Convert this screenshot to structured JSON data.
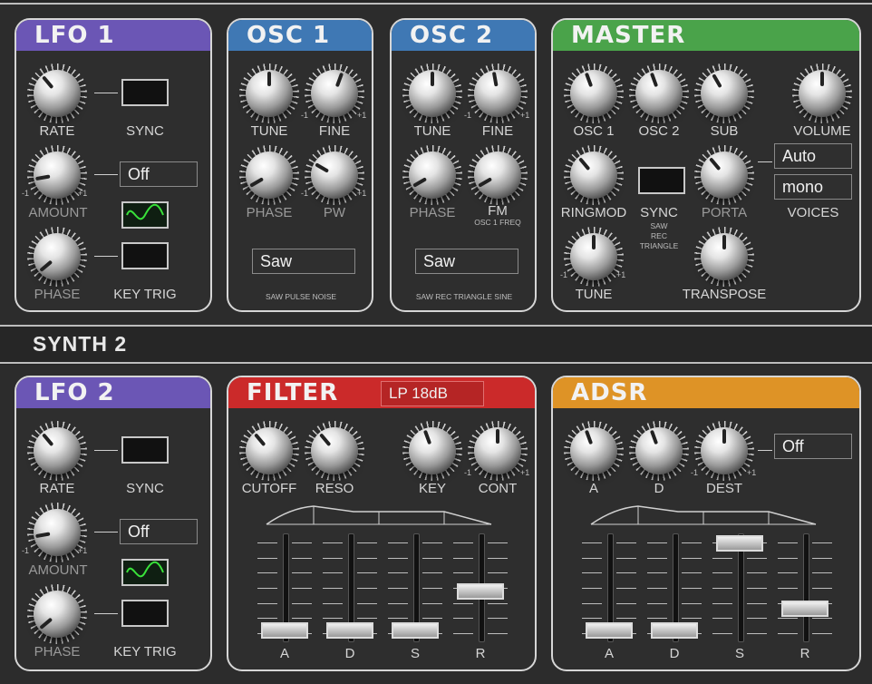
{
  "colors": {
    "lfo": "#6b56b5",
    "osc": "#3f78b4",
    "master": "#4aa34a",
    "filter": "#cb2a2a",
    "adsr": "#de9326"
  },
  "synth1": {
    "lfo1": {
      "title": "LFO 1",
      "rate": "RATE",
      "sync": "SYNC",
      "amount": "AMOUNT",
      "phase": "PHASE",
      "keytrig": "KEY TRIG",
      "mode": "Off",
      "minus": "-1",
      "plus": "+1",
      "wave_icon": "sine-wave-icon"
    },
    "osc1": {
      "title": "OSC 1",
      "tune": "TUNE",
      "fine": "FINE",
      "phase": "PHASE",
      "pw": "PW",
      "wave": "Saw",
      "options": "SAW PULSE NOISE",
      "minus": "-1",
      "plus": "+1"
    },
    "osc2": {
      "title": "OSC 2",
      "tune": "TUNE",
      "fine": "FINE",
      "phase": "PHASE",
      "fm": "FM",
      "fm_sub": "OSC 1 FREQ",
      "wave": "Saw",
      "options": "SAW REC TRIANGLE SINE",
      "minus": "-1",
      "plus": "+1"
    },
    "master": {
      "title": "MASTER",
      "osc1": "OSC 1",
      "osc2": "OSC 2",
      "sub": "SUB",
      "volume": "VOLUME",
      "ringmod": "RINGMOD",
      "sync": "SYNC",
      "sync_opts": [
        "SAW",
        "REC",
        "TRIANGLE"
      ],
      "porta": "PORTA",
      "voices": "VOICES",
      "voices_mode": "Auto",
      "voices_type": "mono",
      "tune": "TUNE",
      "transpose": "TRANSPOSE",
      "minus": "-1",
      "plus": "+1"
    }
  },
  "synth2": {
    "title": "SYNTH 2",
    "lfo2": {
      "title": "LFO 2",
      "rate": "RATE",
      "sync": "SYNC",
      "amount": "AMOUNT",
      "phase": "PHASE",
      "keytrig": "KEY TRIG",
      "mode": "Off",
      "minus": "-1",
      "plus": "+1",
      "wave_icon": "sine-wave-icon"
    },
    "filter": {
      "title": "FILTER",
      "type": "LP 18dB",
      "cutoff": "CUTOFF",
      "reso": "RESO",
      "key": "KEY",
      "cont": "CONT",
      "a": "A",
      "d": "D",
      "s": "S",
      "r": "R",
      "minus": "-1",
      "plus": "+1",
      "levels": {
        "a": 0.0,
        "d": 0.0,
        "s": 0.0,
        "r": 0.45
      }
    },
    "adsr": {
      "title": "ADSR",
      "a": "A",
      "d": "D",
      "dest": "DEST",
      "dest_value": "Off",
      "fa": "A",
      "fd": "D",
      "fs": "S",
      "fr": "R",
      "minus": "-1",
      "plus": "+1",
      "levels": {
        "a": 0.0,
        "d": 0.0,
        "s": 1.0,
        "r": 0.25
      }
    }
  }
}
